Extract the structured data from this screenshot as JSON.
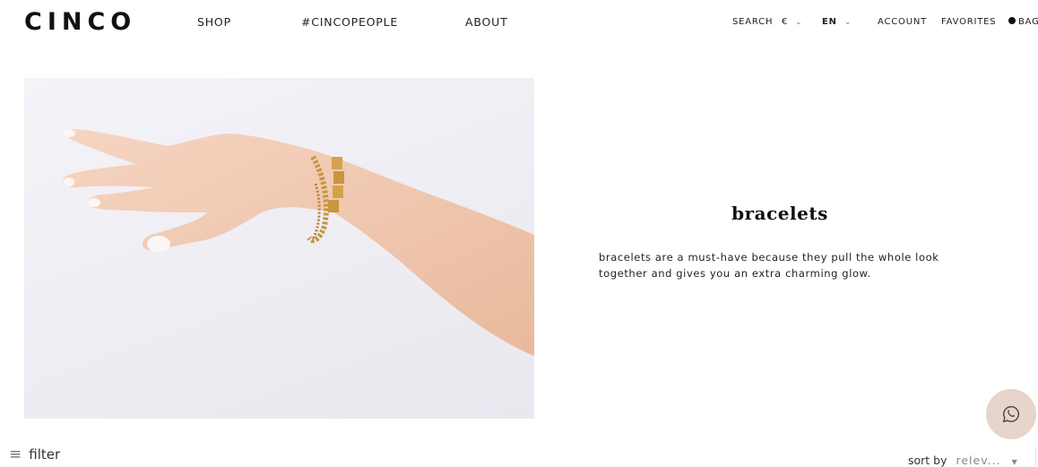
{
  "header": {
    "logo": "CINCO",
    "nav": {
      "shop": "SHOP",
      "people": "#CINCOPEOPLE",
      "about": "ABOUT"
    },
    "utility": {
      "search": "SEARCH",
      "currency": "€",
      "language": "EN",
      "account": "ACCOUNT",
      "favorites": "FAVORITES",
      "bag": "BAG"
    }
  },
  "hero": {
    "title": "bracelets",
    "description": "bracelets are a must-have because they pull the whole look together and gives you an extra charming glow."
  },
  "toolbar": {
    "filter_label": "filter",
    "sort_label": "sort by",
    "sort_value": "relev..."
  },
  "colors": {
    "whatsapp_bg": "#e7d4cb",
    "skin": "#f1cbb4",
    "gold": "#c9953f"
  },
  "icons": {
    "chevron": "chevron-down-icon",
    "bag": "bag-dot-icon",
    "whatsapp": "whatsapp-icon",
    "filter": "menu-icon",
    "sort": "caret-down-icon"
  }
}
